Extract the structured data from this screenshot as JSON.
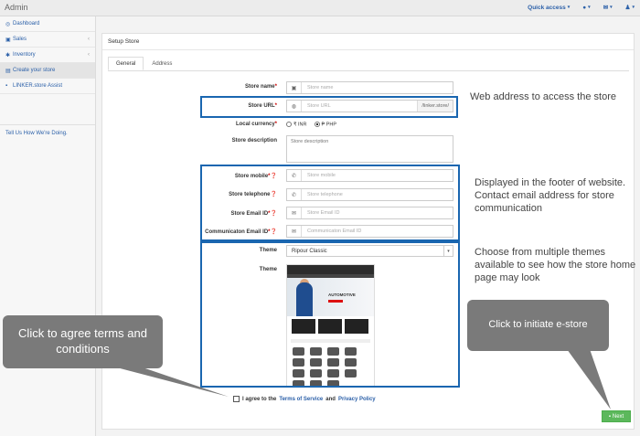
{
  "app": {
    "title": "Admin"
  },
  "topnav": {
    "quick_access": "Quick access",
    "user_icon": "user-icon",
    "mail_icon": "mail-icon",
    "profile_icon": "profile-icon"
  },
  "sidebar": {
    "items": [
      {
        "label": "Dashboard",
        "icon": "dashboard-icon"
      },
      {
        "label": "Sales",
        "icon": "cart-icon"
      },
      {
        "label": "Inventory",
        "icon": "gear-icon"
      },
      {
        "label": "Create your store",
        "icon": "store-icon"
      },
      {
        "label": "LINKER.store Assist",
        "icon": "link-icon"
      }
    ],
    "feedback": "Tell Us How We're Doing."
  },
  "panel": {
    "title": "Setup Store",
    "tabs": [
      "General",
      "Address"
    ]
  },
  "form": {
    "store_name": {
      "label": "Store name",
      "placeholder": "Store name"
    },
    "store_url": {
      "label": "Store URL",
      "placeholder": "Store URL",
      "suffix": "/linker.store/"
    },
    "currency": {
      "label": "Local currency",
      "options": [
        "₹ INR",
        "₱ PHP"
      ],
      "selected": "₱ PHP"
    },
    "description": {
      "label": "Store description",
      "placeholder": "Store description"
    },
    "mobile": {
      "label": "Store mobile",
      "placeholder": "Store mobile"
    },
    "telephone": {
      "label": "Store telephone",
      "placeholder": "Store telephone"
    },
    "email": {
      "label": "Store Email ID",
      "placeholder": "Store Email ID"
    },
    "comm_email": {
      "label": "Communicaton Email ID",
      "placeholder": "Communicaton Email ID"
    },
    "theme_select": {
      "label": "Theme",
      "value": "Ripour Classic"
    },
    "theme_preview": {
      "label": "Theme",
      "hero_text": "AUTOMOTIVE"
    },
    "agree": {
      "prefix": "I agree to the",
      "terms": "Terms of Service",
      "and": "and",
      "privacy": "Privacy Policy"
    },
    "next": "Next"
  },
  "annotations": {
    "url_note": "Web address to access the store",
    "footer_note": "Displayed in the footer of website.\nContact email address for store communication",
    "theme_note": "Choose from multiple themes available to see how the store home page may look",
    "terms_callout": "Click to agree terms and conditions",
    "next_callout": "Click to initiate e-store"
  },
  "colors": {
    "highlight": "#1a66b0",
    "callout": "#7a7a7a",
    "next_button": "#5cb85c",
    "link": "#2a5fa8"
  }
}
